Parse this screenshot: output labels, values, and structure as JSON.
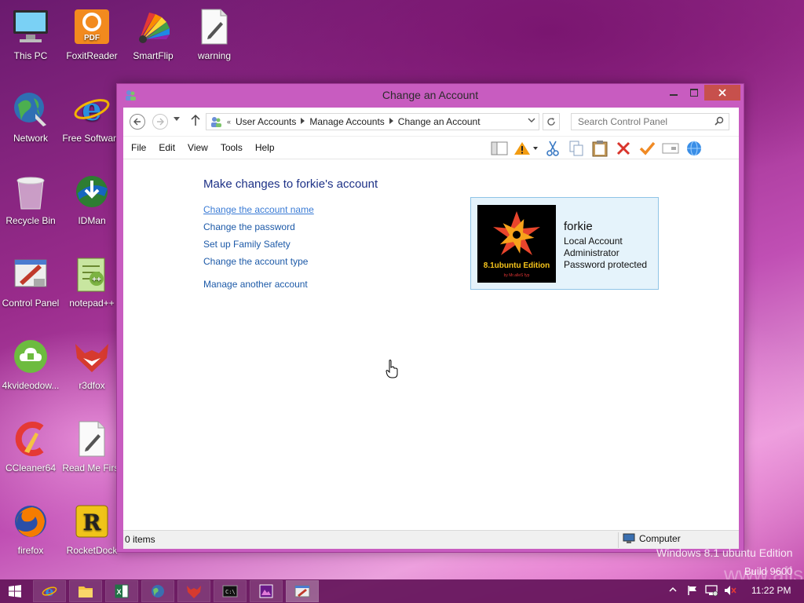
{
  "desktop": {
    "icons": [
      {
        "label": "This PC"
      },
      {
        "label": "FoxitReader"
      },
      {
        "label": "SmartFlip"
      },
      {
        "label": "warning"
      },
      {
        "label": "Network"
      },
      {
        "label": "Free Software"
      },
      {
        "label": "Recycle Bin"
      },
      {
        "label": "IDMan"
      },
      {
        "label": "Control Panel"
      },
      {
        "label": "notepad++"
      },
      {
        "label": "4kvideodow..."
      },
      {
        "label": "r3dfox"
      },
      {
        "label": "CCleaner64"
      },
      {
        "label": "Read Me First"
      },
      {
        "label": "firefox"
      },
      {
        "label": "RocketDock"
      }
    ],
    "watermark_line1": "Windows 8.1 ubuntu Edition",
    "watermark_line2": "Build 9600",
    "watermark_url": "www.alls"
  },
  "window": {
    "title": "Change an Account",
    "address": {
      "prefix": "«",
      "crumbs": [
        "User Accounts",
        "Manage Accounts",
        "Change an Account"
      ]
    },
    "search_placeholder": "Search Control Panel",
    "menu": [
      "File",
      "Edit",
      "View",
      "Tools",
      "Help"
    ],
    "heading": "Make changes to forkie's account",
    "links": [
      "Change the account name",
      "Change the password",
      "Set up Family Safety",
      "Change the account type",
      "Manage another account"
    ],
    "account": {
      "name": "forkie",
      "details": [
        "Local Account",
        "Administrator",
        "Password protected"
      ],
      "avatar_text": "8.1ubuntu Edition",
      "avatar_subtext": "by Mr.alleS fyp"
    },
    "status": {
      "items": "0 items",
      "zone": "Computer"
    }
  },
  "taskbar": {
    "clock": "11:22 PM"
  },
  "colors": {
    "window_frame": "#c85cc0",
    "link": "#1d5aa8",
    "heading": "#1e3287",
    "card_bg": "#e5f3fb",
    "card_border": "#8fc4e6",
    "close_button": "#c7504c"
  }
}
